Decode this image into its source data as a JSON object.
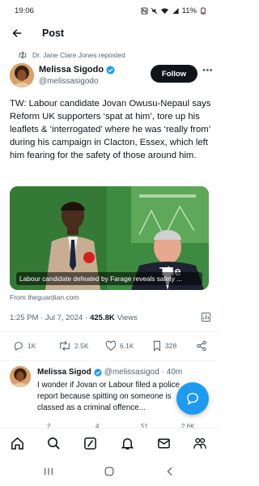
{
  "status_bar": {
    "time": "19:06",
    "battery": "11%"
  },
  "header": {
    "title": "Post"
  },
  "repost": {
    "text": "Dr. Jane Clare Jones reposted"
  },
  "author": {
    "name": "Melissa Sigodo",
    "handle": "@melissasigodo",
    "follow_label": "Follow"
  },
  "tweet": {
    "text": "TW: Labour candidate Jovan Owusu-Nepaul says Reform UK supporters ‘spat at him’, tore up his leaflets & ‘interrogated’ where he was ‘really from’ during his campaign in Clacton, Essex, which left him fearing for the safety of those around him.",
    "media_caption": "Labour candidate defeated by Farage reveals safety ...",
    "source": "From theguardian.com",
    "time": "1:25 PM · Jul 7, 2024 ·",
    "views": "425.8K",
    "views_label": "Views"
  },
  "actions": {
    "replies": "1K",
    "reposts": "2.5K",
    "likes": "6.1K",
    "bookmarks": "328"
  },
  "reply": {
    "name": "Melissa Sigod",
    "handle": "@melissasigod",
    "time": "· 40m",
    "text": "I wonder if Jovan or Labour filed a police report because spitting on someone is classed as a criminal offence...",
    "counts": [
      "2",
      "4",
      "51",
      "2.6K"
    ]
  },
  "colors": {
    "accent": "#1d9bf0",
    "verified": "#1d9bf0",
    "text": "#0f1419",
    "muted": "#536471",
    "follow_bg": "#0f1419"
  },
  "icons": {
    "back": "arrow-left-icon",
    "repost": "repost-icon",
    "verified": "verified-badge-icon",
    "more": "more-dots-icon",
    "analytics": "analytics-icon",
    "reply": "reply-icon",
    "like": "heart-icon",
    "bookmark": "bookmark-icon",
    "share": "share-icon",
    "compose": "compose-icon",
    "home": "home-icon",
    "search": "search-icon",
    "grok": "grok-icon",
    "notifications": "bell-icon",
    "messages": "mail-icon",
    "communities": "communities-icon"
  }
}
